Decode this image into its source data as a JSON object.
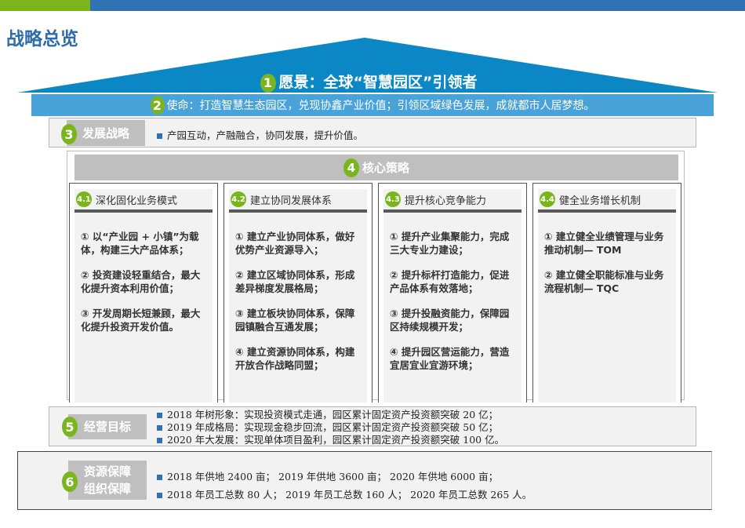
{
  "title": "战略总览",
  "vision": {
    "num": "1",
    "text": "愿景：全球“智慧园区”引领者"
  },
  "mission": {
    "num": "2",
    "text": "使命：打造智慧生态园区，兑现协鑫产业价值；引领区域绿色发展，成就都市人居梦想。"
  },
  "strategy": {
    "num": "3",
    "label": "发展战略",
    "text": "产园互动，产融融合，协同发展，提升价值。"
  },
  "core": {
    "num": "4",
    "label": "核心策略",
    "columns": [
      {
        "num": "4.1",
        "title": "深化固化业务模式",
        "items": [
          "① 以“产业园 + 小镇”为载体，构建三大产品体系；",
          "② 投资建设轻重结合，最大化提升资本利用价值；",
          "③ 开发周期长短兼顾，最大化提升投资开发价值。"
        ]
      },
      {
        "num": "4.2",
        "title": "建立协同发展体系",
        "items": [
          "① 建立产业协同体系，做好优势产业资源导入；",
          "② 建立区域协同体系，形成差异梯度发展格局；",
          "③ 建立板块协同体系，保障园镇融合互通发展；",
          "④ 建立资源协同体系，构建开放合作战略同盟；"
        ]
      },
      {
        "num": "4.3",
        "title": "提升核心竞争能力",
        "items": [
          "① 提升产业集聚能力，完成三大专业力建设；",
          "② 提升标杆打造能力，促进产品体系有效落地；",
          "③ 提升投融资能力，保障园区持续规模开发；",
          "④ 提升园区营运能力，营造宜居宜业宜游环境；"
        ]
      },
      {
        "num": "4.4",
        "title": "健全业务增长机制",
        "items": [
          "① 建立健全业绩管理与业务推动机制— TOM",
          "② 建立健全职能标准与业务流程机制— TQC"
        ]
      }
    ]
  },
  "goals": {
    "num": "5",
    "label": "经营目标",
    "lines": [
      "2018 年树形象：实现投资模式走通，园区累计固定资产投资额突破 20 亿；",
      "2019 年成格局：实现现金稳步回流，园区累计固定资产投资额突破 50 亿；",
      "2020 年大发展：实现单体项目盈利，园区累计固定资产投资额突破 100 亿。"
    ]
  },
  "resources": {
    "num": "6",
    "label1": "资源保障",
    "label2": "组织保障",
    "lines": [
      "2018 年供地 2400 亩； 2019 年供地 3600 亩； 2020 年供地 6000 亩；",
      "2018 年员工总数 80 人； 2019 年员工总数 160 人； 2020 年员工总数 265 人。"
    ]
  },
  "colors": {
    "green": "#7ab51d",
    "blue": "#2f72b4",
    "roof": "#0b87c5",
    "mission": "#4aa3d8"
  }
}
